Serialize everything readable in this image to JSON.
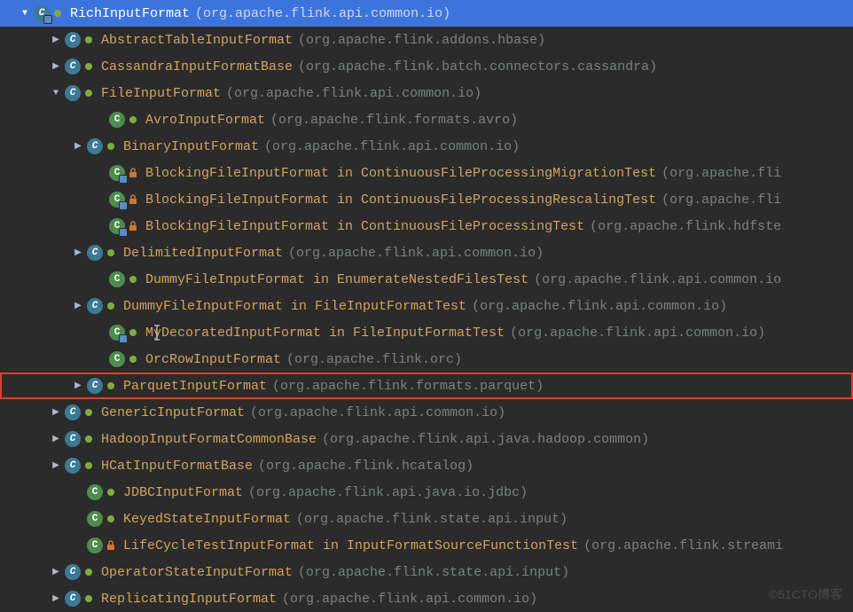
{
  "watermark": "©51CTO博客",
  "nodes": [
    {
      "indent": 20,
      "arrow": "down",
      "iconType": "abstract",
      "overlay": true,
      "vis": "public",
      "name": "RichInputFormat",
      "pkg": "(org.apache.flink.api.common.io)",
      "selected": true
    },
    {
      "indent": 55,
      "arrow": "right",
      "iconType": "abstract",
      "overlay": false,
      "vis": "public",
      "name": "AbstractTableInputFormat",
      "pkg": "(org.apache.flink.addons.hbase)"
    },
    {
      "indent": 55,
      "arrow": "right",
      "iconType": "abstract",
      "overlay": false,
      "vis": "public",
      "name": "CassandraInputFormatBase",
      "pkg": "(org.apache.flink.batch.connectors.cassandra)"
    },
    {
      "indent": 55,
      "arrow": "down",
      "iconType": "abstract",
      "overlay": false,
      "vis": "public",
      "name": "FileInputFormat",
      "pkg": "(org.apache.flink.api.common.io)"
    },
    {
      "indent": 105,
      "arrow": "none",
      "iconType": "concrete",
      "overlay": false,
      "vis": "public",
      "name": "AvroInputFormat",
      "pkg": "(org.apache.flink.formats.avro)"
    },
    {
      "indent": 80,
      "arrow": "right",
      "iconType": "abstract",
      "overlay": false,
      "vis": "public",
      "name": "BinaryInputFormat",
      "pkg": "(org.apache.flink.api.common.io)"
    },
    {
      "indent": 105,
      "arrow": "none",
      "iconType": "concrete",
      "overlay": true,
      "vis": "private",
      "name": "BlockingFileInputFormat in ContinuousFileProcessingMigrationTest",
      "pkg": "(org.apache.fli"
    },
    {
      "indent": 105,
      "arrow": "none",
      "iconType": "concrete",
      "overlay": true,
      "vis": "private",
      "name": "BlockingFileInputFormat in ContinuousFileProcessingRescalingTest",
      "pkg": "(org.apache.fli"
    },
    {
      "indent": 105,
      "arrow": "none",
      "iconType": "concrete",
      "overlay": true,
      "vis": "private",
      "name": "BlockingFileInputFormat in ContinuousFileProcessingTest",
      "pkg": "(org.apache.flink.hdfste"
    },
    {
      "indent": 80,
      "arrow": "right",
      "iconType": "abstract",
      "overlay": false,
      "vis": "public",
      "name": "DelimitedInputFormat",
      "pkg": "(org.apache.flink.api.common.io)"
    },
    {
      "indent": 105,
      "arrow": "none",
      "iconType": "concrete",
      "overlay": false,
      "vis": "public",
      "name": "DummyFileInputFormat in EnumerateNestedFilesTest",
      "pkg": "(org.apache.flink.api.common.io"
    },
    {
      "indent": 80,
      "arrow": "right",
      "iconType": "abstract",
      "overlay": false,
      "vis": "public",
      "name": "DummyFileInputFormat in FileInputFormatTest",
      "pkg": "(org.apache.flink.api.common.io)"
    },
    {
      "indent": 105,
      "arrow": "none",
      "iconType": "concrete",
      "overlay": true,
      "vis": "public",
      "name": "MyDecoratedInputFormat in FileInputFormatTest",
      "pkg": "(org.apache.flink.api.common.io)",
      "caret": true
    },
    {
      "indent": 105,
      "arrow": "none",
      "iconType": "concrete",
      "overlay": false,
      "vis": "public",
      "name": "OrcRowInputFormat",
      "pkg": "(org.apache.flink.orc)"
    },
    {
      "indent": 80,
      "arrow": "right",
      "iconType": "abstract",
      "overlay": false,
      "vis": "public",
      "name": "ParquetInputFormat",
      "pkg": "(org.apache.flink.formats.parquet)",
      "highlighted": true
    },
    {
      "indent": 55,
      "arrow": "right",
      "iconType": "abstract",
      "overlay": false,
      "vis": "public",
      "name": "GenericInputFormat",
      "pkg": "(org.apache.flink.api.common.io)"
    },
    {
      "indent": 55,
      "arrow": "right",
      "iconType": "abstract",
      "overlay": false,
      "vis": "public",
      "name": "HadoopInputFormatCommonBase",
      "pkg": "(org.apache.flink.api.java.hadoop.common)"
    },
    {
      "indent": 55,
      "arrow": "right",
      "iconType": "abstract",
      "overlay": false,
      "vis": "public",
      "name": "HCatInputFormatBase",
      "pkg": "(org.apache.flink.hcatalog)"
    },
    {
      "indent": 80,
      "arrow": "none",
      "iconType": "concrete",
      "overlay": false,
      "vis": "public",
      "name": "JDBCInputFormat",
      "pkg": "(org.apache.flink.api.java.io.jdbc)"
    },
    {
      "indent": 80,
      "arrow": "none",
      "iconType": "concrete",
      "overlay": false,
      "vis": "public",
      "name": "KeyedStateInputFormat",
      "pkg": "(org.apache.flink.state.api.input)"
    },
    {
      "indent": 80,
      "arrow": "none",
      "iconType": "concrete",
      "overlay": false,
      "vis": "private",
      "name": "LifeCycleTestInputFormat in InputFormatSourceFunctionTest",
      "pkg": "(org.apache.flink.streami"
    },
    {
      "indent": 55,
      "arrow": "right",
      "iconType": "abstract",
      "overlay": false,
      "vis": "public",
      "name": "OperatorStateInputFormat",
      "pkg": "(org.apache.flink.state.api.input)"
    },
    {
      "indent": 55,
      "arrow": "right",
      "iconType": "abstract",
      "overlay": false,
      "vis": "public",
      "name": "ReplicatingInputFormat",
      "pkg": "(org.apache.flink.api.common.io)"
    }
  ]
}
